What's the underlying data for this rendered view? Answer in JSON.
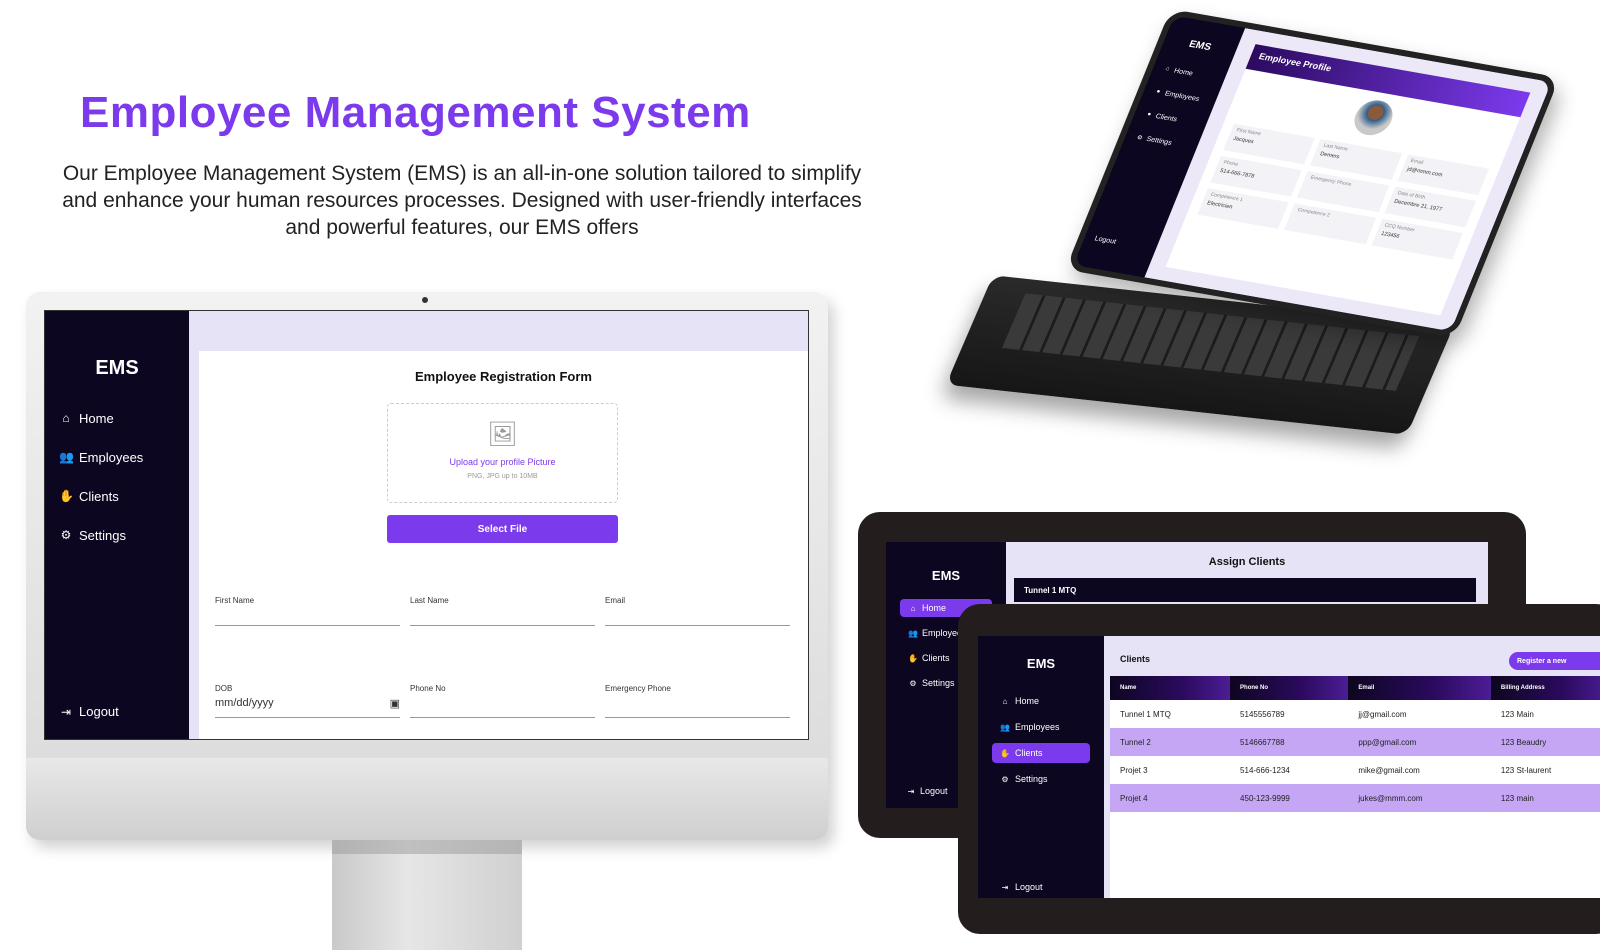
{
  "hero": {
    "title": "Employee  Management System",
    "description": "Our Employee Management System (EMS) is an all-in-one solution tailored to simplify and enhance your human resources processes. Designed with user-friendly interfaces and powerful features, our EMS offers"
  },
  "colors": {
    "accent": "#7c3aed",
    "sidebar": "#0d0620",
    "panel_bg": "#e7e3f7"
  },
  "nav": {
    "logo": "EMS",
    "items": [
      {
        "label": "Home",
        "icon": "home-icon"
      },
      {
        "label": "Employees",
        "icon": "users-icon"
      },
      {
        "label": "Clients",
        "icon": "handshake-icon"
      },
      {
        "label": "Settings",
        "icon": "gear-icon"
      }
    ],
    "logout": "Logout"
  },
  "monitor": {
    "form_title": "Employee Registration Form",
    "upload_text": "Upload your profile Picture",
    "upload_hint": "PNG, JPG up to 10MB",
    "select_button": "Select File",
    "fields": {
      "first_name": "First Name",
      "last_name": "Last Name",
      "email": "Email",
      "dob": "DOB",
      "dob_placeholder": "mm/dd/yyyy",
      "phone": "Phone No",
      "emergency": "Emergency Phone"
    }
  },
  "tablet": {
    "header": "Employee Profile",
    "cells": [
      {
        "label": "First Name",
        "value": "Jacques"
      },
      {
        "label": "Last Name",
        "value": "Demers"
      },
      {
        "label": "Email",
        "value": "jd@mmm.com"
      },
      {
        "label": "Phone",
        "value": "514-666-7878"
      },
      {
        "label": "Emergency Phone",
        "value": ""
      },
      {
        "label": "Date of Birth",
        "value": "Decembre 21, 1977"
      },
      {
        "label": "Competence 1",
        "value": "Electricien"
      },
      {
        "label": "Competence 2",
        "value": ""
      },
      {
        "label": "CCQ Number",
        "value": "123456"
      }
    ]
  },
  "assign": {
    "title": "Assign Clients",
    "bar": "Tunnel 1 MTQ",
    "active_item": "Home"
  },
  "clients": {
    "title": "Clients",
    "register_button": "Register a new",
    "columns": [
      "Name",
      "Phone No",
      "Email",
      "Billing Address"
    ],
    "rows": [
      [
        "Tunnel 1 MTQ",
        "5145556789",
        "jj@gmail.com",
        "123 Main"
      ],
      [
        "Tunnel 2",
        "5146667788",
        "ppp@gmail.com",
        "123 Beaudry"
      ],
      [
        "Projet 3",
        "514-666-1234",
        "mike@gmail.com",
        "123 St-laurent"
      ],
      [
        "Projet 4",
        "450-123-9999",
        "jukes@mmm.com",
        "123 main"
      ]
    ],
    "active_item": "Clients"
  }
}
